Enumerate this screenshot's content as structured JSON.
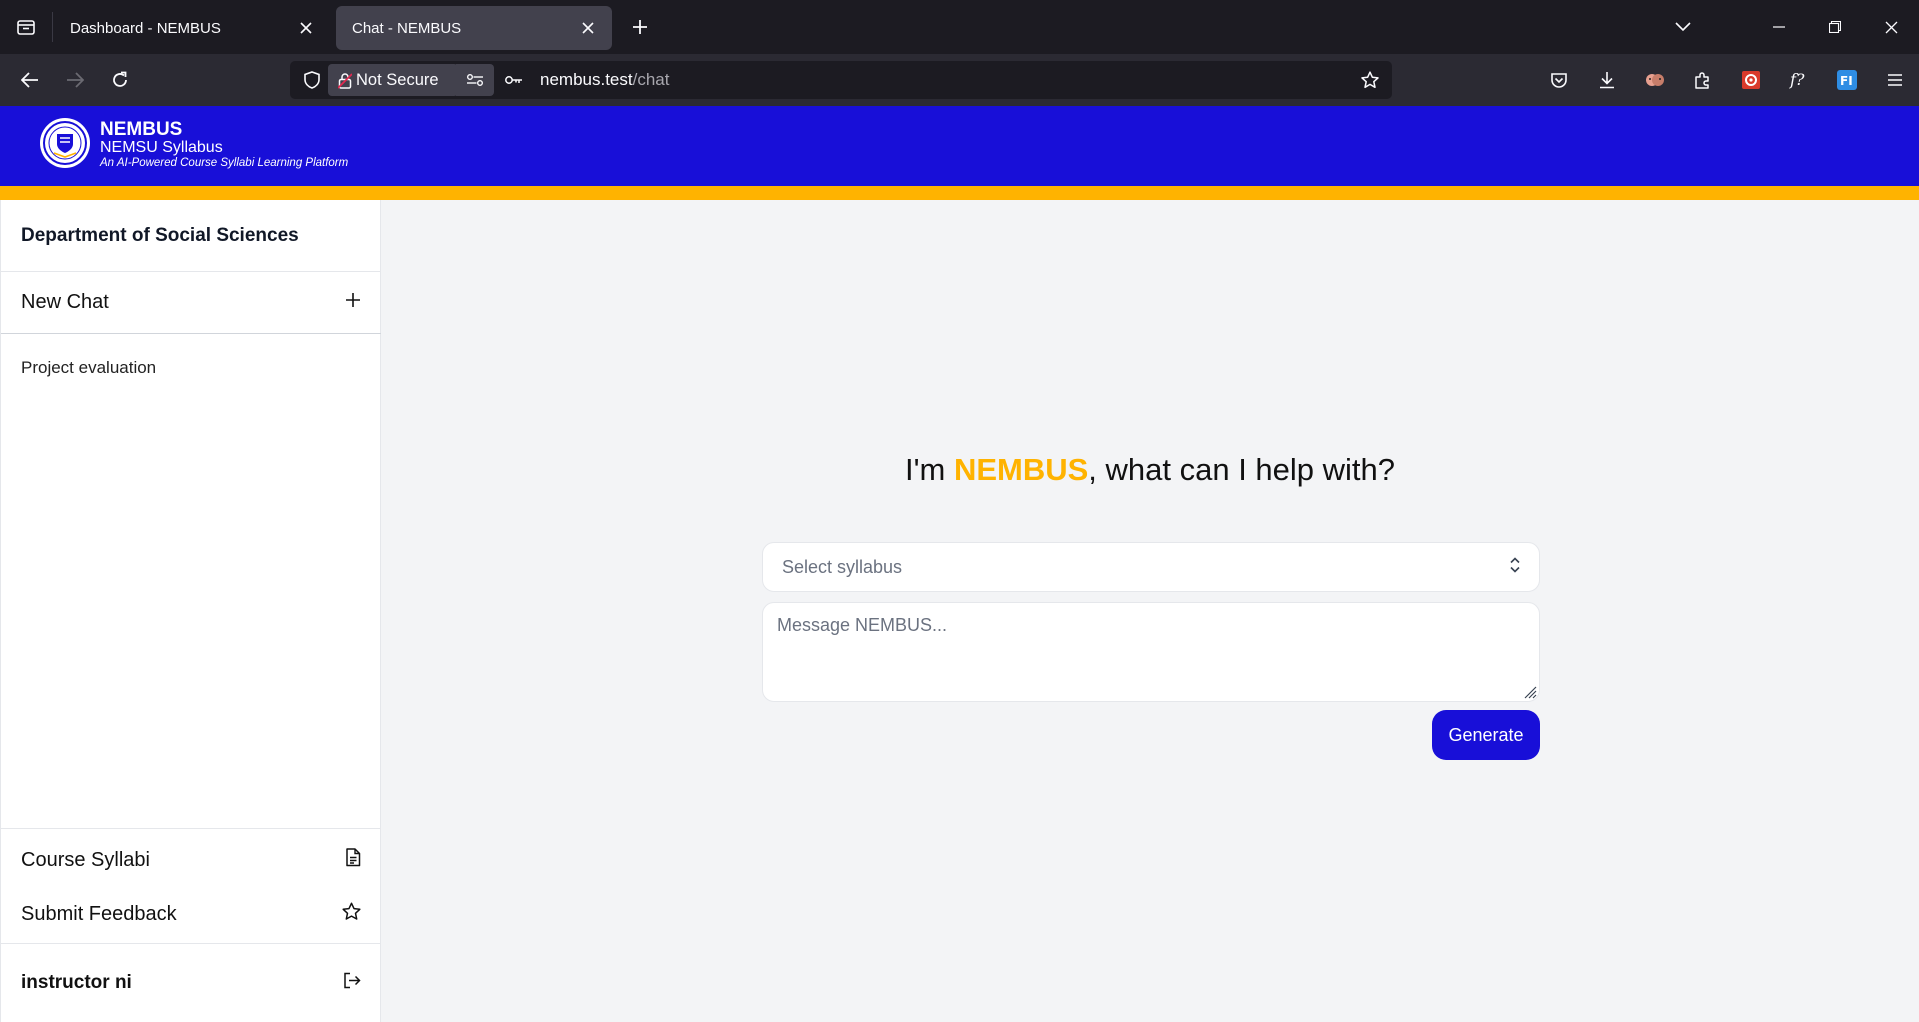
{
  "browser": {
    "tabs": [
      {
        "title": "Dashboard - NEMBUS",
        "active": false
      },
      {
        "title": "Chat - NEMBUS",
        "active": true
      }
    ],
    "security_label": "Not Secure",
    "url_host": "nembus.test",
    "url_path": "/chat"
  },
  "header": {
    "brand_name": "NEMBUS",
    "brand_sub": "NEMSU Syllabus",
    "tagline": "An AI-Powered Course Syllabi Learning Platform"
  },
  "sidebar": {
    "department": "Department of Social Sciences",
    "new_chat_label": "New Chat",
    "history": [
      "Project evaluation"
    ],
    "links": [
      {
        "label": "Course Syllabi",
        "icon": "document-icon"
      },
      {
        "label": "Submit Feedback",
        "icon": "star-icon"
      }
    ],
    "user_name": "instructor ni"
  },
  "main": {
    "greeting_prefix": "I'm ",
    "greeting_brand": "NEMBUS",
    "greeting_suffix": ", what can I help with?",
    "select_placeholder": "Select syllabus",
    "message_placeholder": "Message NEMBUS...",
    "generate_label": "Generate"
  },
  "colors": {
    "brand_blue": "#180fd8",
    "accent_gold": "#ffb300"
  }
}
